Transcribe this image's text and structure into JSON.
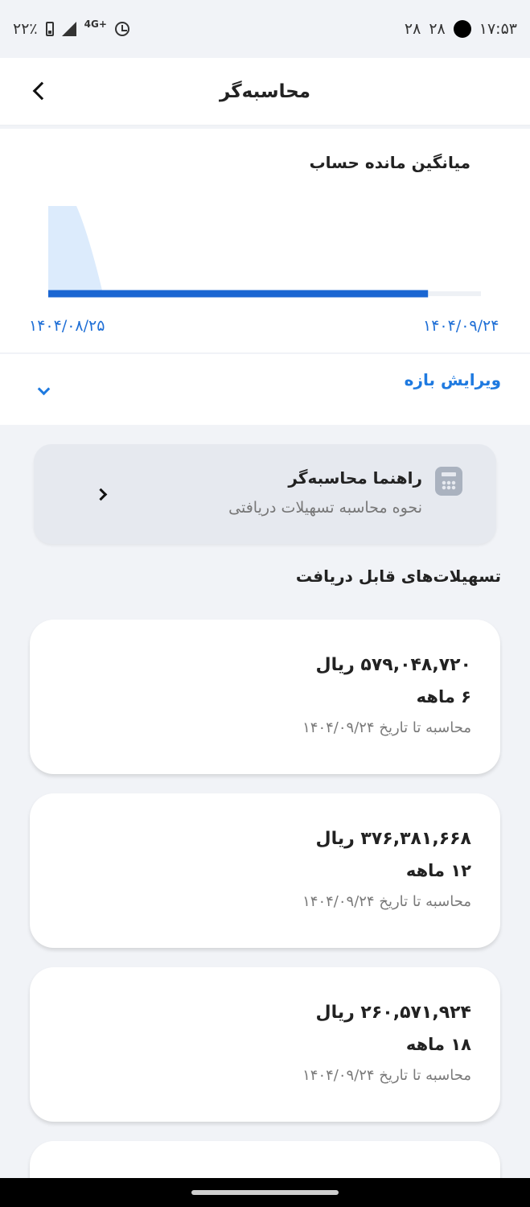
{
  "status_bar": {
    "time": "۱۷:۵۳",
    "notif_1": "۲۸",
    "notif_2": "۲۸",
    "battery": "۲۲٪",
    "network": "4G+"
  },
  "header": {
    "title": "محاسبه‌گر"
  },
  "chart": {
    "title": "میانگین مانده حساب",
    "start_date": "۱۴۰۴/۰۸/۲۵",
    "end_date": "۱۴۰۴/۰۹/۲۴"
  },
  "chart_data": {
    "type": "area",
    "title": "میانگین مانده حساب",
    "x_labels": [
      "۱۴۰۴/۰۸/۲۵",
      "۱۴۰۴/۰۹/۲۴"
    ],
    "series": [
      {
        "values": [
          1.0,
          0.7,
          0.0,
          0.0,
          0.0,
          0.0,
          0.0,
          0.0,
          0.0,
          0.0
        ]
      }
    ],
    "progress": 0.9,
    "grid": false,
    "colors": {
      "area": "#dcebfc",
      "progress": "#1a66d2",
      "track": "#eef1f5"
    }
  },
  "range": {
    "label": "ویرایش بازه"
  },
  "guide": {
    "title": "راهنما محاسبه‌گر",
    "subtitle": "نحوه محاسبه تسهیلات دریافتی",
    "icon": "calculator-icon"
  },
  "loans": {
    "section_title": "تسهیلات‌های قابل دریافت",
    "items": [
      {
        "amount": "۵۷۹,۰۴۸,۷۲۰ ریال",
        "term": "۶ ماهه",
        "date": "محاسبه تا تاریخ ۱۴۰۴/۰۹/۲۴"
      },
      {
        "amount": "۳۷۶,۳۸۱,۶۶۸ ریال",
        "term": "۱۲ ماهه",
        "date": "محاسبه تا تاریخ ۱۴۰۴/۰۹/۲۴"
      },
      {
        "amount": "۲۶۰,۵۷۱,۹۲۴ ریال",
        "term": "۱۸ ماهه",
        "date": "محاسبه تا تاریخ ۱۴۰۴/۰۹/۲۴"
      }
    ]
  },
  "colors": {
    "accent": "#1f7ae0",
    "background": "#f1f3f7"
  }
}
